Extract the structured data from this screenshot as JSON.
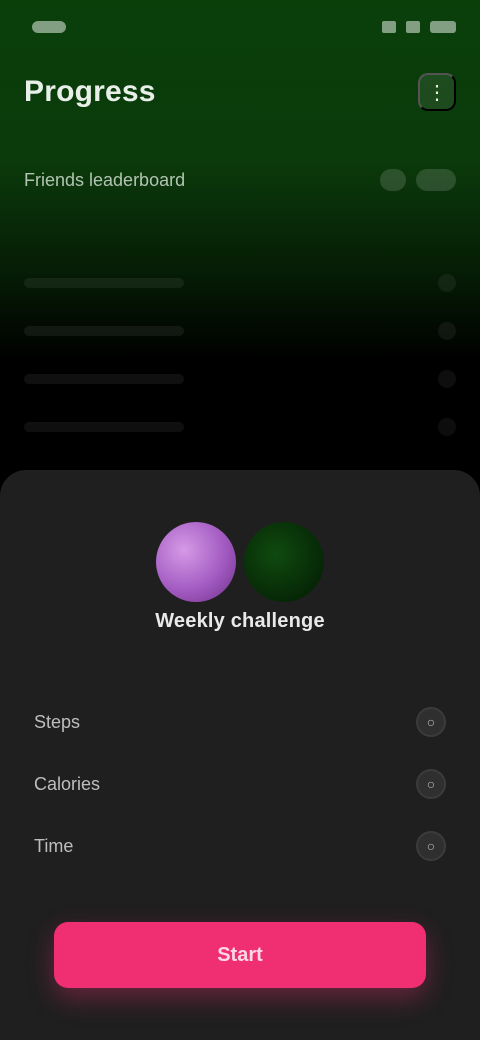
{
  "status_bar": {
    "time": "",
    "icons": [
      "wifi-icon",
      "signal-icon",
      "battery-icon"
    ]
  },
  "header": {
    "title": "Progress",
    "action_icon": "menu-icon"
  },
  "subheader": {
    "label": "Friends leaderboard"
  },
  "sheet": {
    "title": "Weekly challenge",
    "avatars": [
      {
        "label": "",
        "color": "#b06cc9"
      },
      {
        "label": "",
        "color": "#0b3a0b"
      }
    ],
    "items": [
      {
        "label": "Steps",
        "state": "off"
      },
      {
        "label": "Calories",
        "state": "off"
      },
      {
        "label": "Time",
        "state": "off"
      }
    ],
    "primary_action": {
      "label": "Start"
    }
  },
  "colors": {
    "accent": "#ef2f71",
    "top_gradient": "#0a3f0a",
    "sheet_bg": "#1f1f1f"
  }
}
